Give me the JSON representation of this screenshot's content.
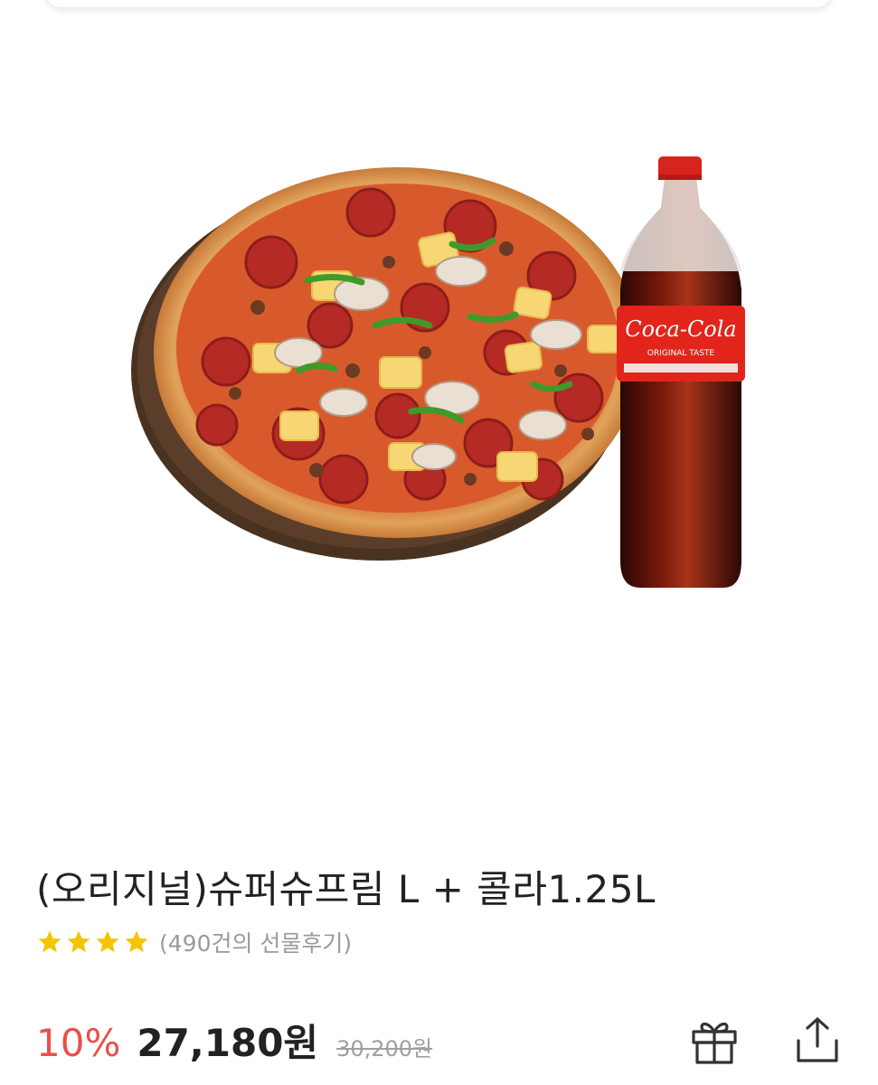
{
  "product": {
    "image_alt": "Super Supreme pizza with Coca-Cola 1.25L bottle",
    "bottle_brand": "Coca-Cola",
    "bottle_subtext": "ORIGINAL TASTE",
    "title": "(오리지널)슈퍼슈프림 L + 콜라1.25L",
    "rating": {
      "stars": 4,
      "max_stars": 5,
      "review_text": "(490건의 선물후기)"
    },
    "price": {
      "discount": "10%",
      "sale_price": "27,180원",
      "original_price": "30,200원"
    }
  },
  "actions": {
    "gift_icon": "gift-icon",
    "share_icon": "share-icon"
  },
  "colors": {
    "discount": "#e8504a",
    "star": "#f5c400",
    "text": "#222222",
    "muted": "#9a9a9a"
  }
}
